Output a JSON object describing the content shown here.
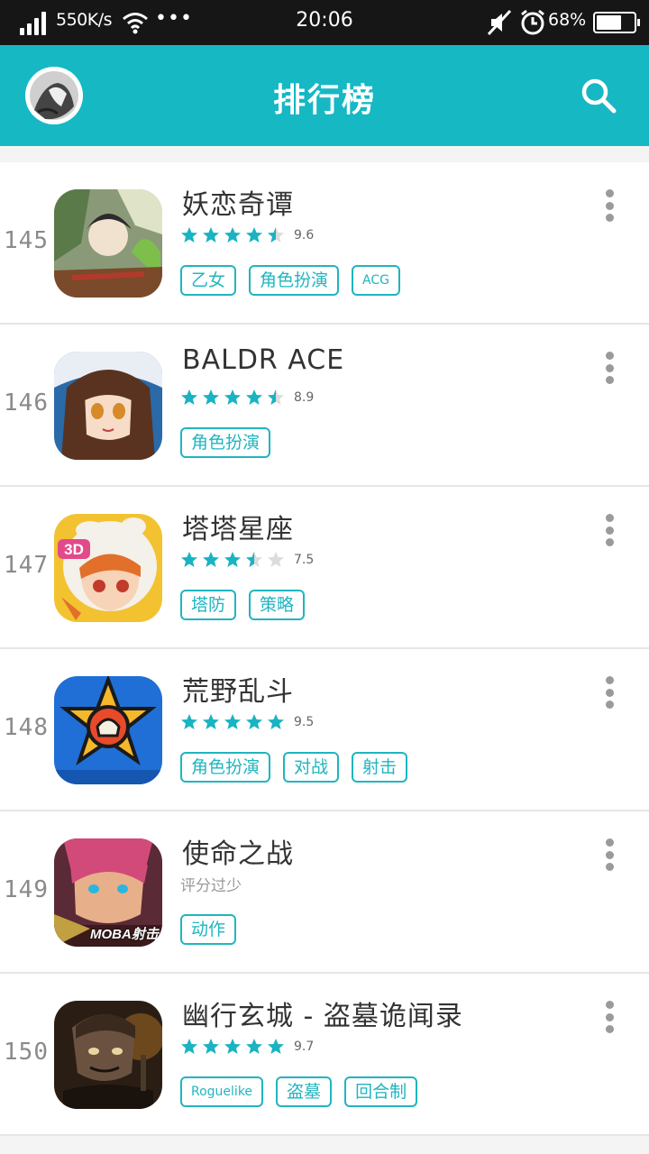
{
  "status_bar": {
    "net_speed": "550K/s",
    "more": "•••",
    "time": "20:06",
    "battery_percent": "68%",
    "battery_level": 0.68
  },
  "header": {
    "title": "排行榜"
  },
  "accent_color": "#16b8c4",
  "apps": [
    {
      "rank": "145",
      "name": "妖恋奇谭",
      "rating": 4.8,
      "score": "9.6",
      "tags": [
        "乙女",
        "角色扮演",
        "ACG"
      ],
      "icon": "yaolian-icon"
    },
    {
      "rank": "146",
      "name": "BALDR ACE",
      "rating": 4.5,
      "score": "8.9",
      "tags": [
        "角色扮演"
      ],
      "icon": "baldr-icon"
    },
    {
      "rank": "147",
      "name": "塔塔星座",
      "rating": 3.5,
      "score": "7.5",
      "tags": [
        "塔防",
        "策略"
      ],
      "icon": "tata-icon"
    },
    {
      "rank": "148",
      "name": "荒野乱斗",
      "rating": 5,
      "score": "9.5",
      "tags": [
        "角色扮演",
        "对战",
        "射击"
      ],
      "icon": "brawl-icon"
    },
    {
      "rank": "149",
      "name": "使命之战",
      "rating_text": "评分过少",
      "tags": [
        "动作"
      ],
      "icon": "shiming-icon",
      "icon_text": "MOBA射击"
    },
    {
      "rank": "150",
      "name": "幽行玄城 - 盗墓诡闻录",
      "rating": 5,
      "score": "9.7",
      "tags": [
        "Roguelike",
        "盗墓",
        "回合制"
      ],
      "icon": "youxing-icon"
    }
  ]
}
